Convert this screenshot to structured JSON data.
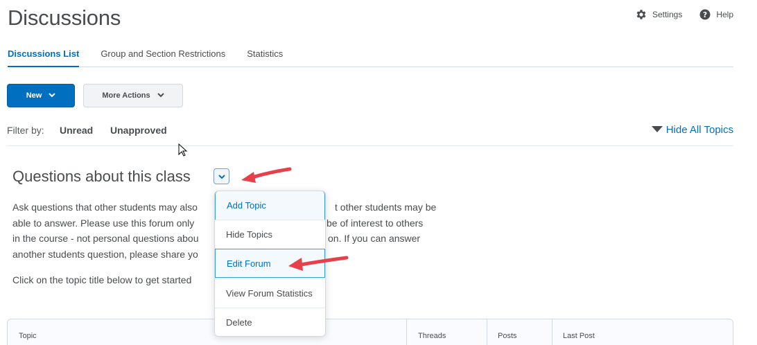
{
  "page": {
    "title": "Discussions"
  },
  "top_links": {
    "settings": {
      "label": "Settings",
      "icon": "gear-icon"
    },
    "help": {
      "label": "Help",
      "icon": "help-circle-icon"
    }
  },
  "tabs": [
    {
      "label": "Discussions List",
      "active": true
    },
    {
      "label": "Group and Section Restrictions",
      "active": false
    },
    {
      "label": "Statistics",
      "active": false
    }
  ],
  "toolbar": {
    "new_label": "New",
    "more_actions_label": "More Actions"
  },
  "filter": {
    "label": "Filter by:",
    "unread": "Unread",
    "unapproved": "Unapproved",
    "hide_all": "Hide All Topics"
  },
  "forum": {
    "title": "Questions about this class",
    "description_lines": [
      "Ask questions that other students may also",
      "able to answer.  Please use this forum only",
      "in the course - not personal questions abou",
      "another students question, please share yo"
    ],
    "description_right_lines": [
      "t other students may be",
      "be of interest to others",
      "on.  If you can answer"
    ],
    "click_hint": "Click on the topic title below to get started"
  },
  "dropdown": {
    "items": [
      {
        "label": "Add Topic",
        "highlighted": true
      },
      {
        "label": "Hide Topics",
        "highlighted": false
      },
      {
        "label": "Edit Forum",
        "highlighted": true
      },
      {
        "label": "View Forum Statistics",
        "highlighted": false
      },
      {
        "label": "Delete",
        "highlighted": false
      }
    ]
  },
  "table": {
    "columns": [
      "Topic",
      "Threads",
      "Posts",
      "Last Post"
    ]
  },
  "colors": {
    "accent": "#006fbf",
    "annotation_arrow": "#e8404a",
    "text": "#494c4e"
  }
}
